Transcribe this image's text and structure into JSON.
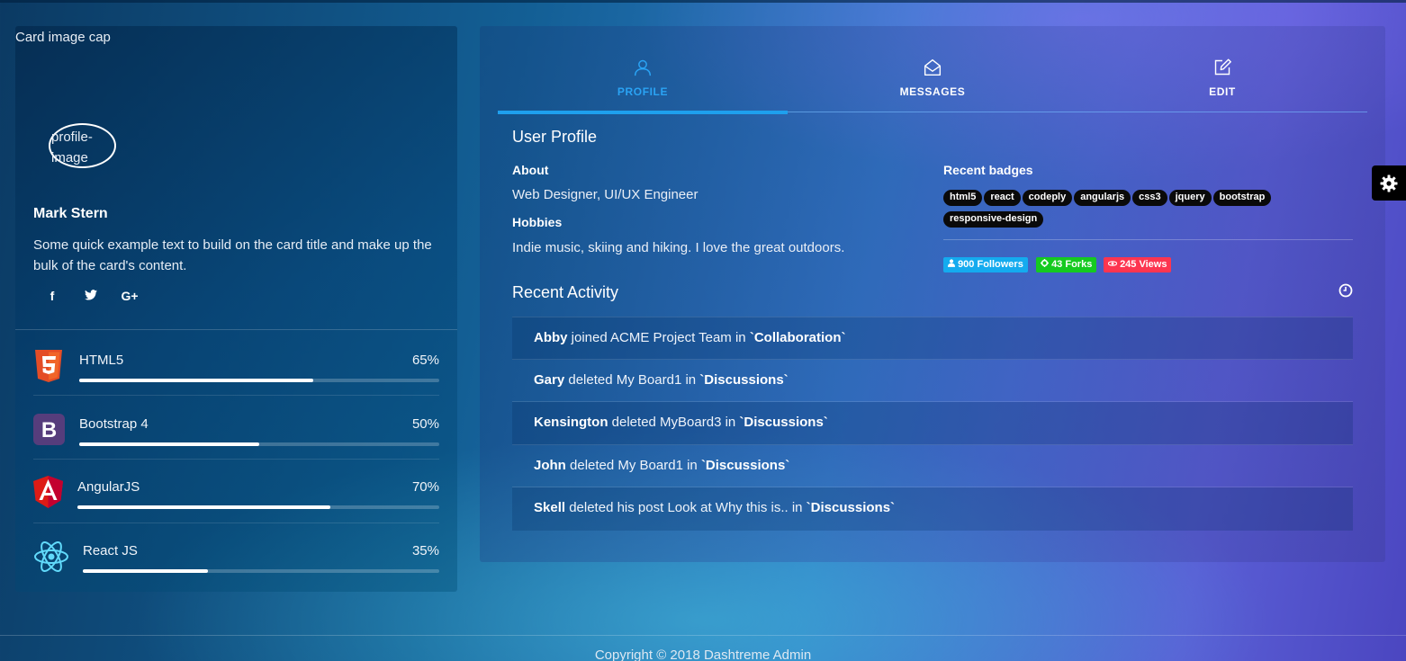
{
  "profile_card": {
    "image_cap": "Card image cap",
    "avatar_alt": "profile-image",
    "name": "Mark Stern",
    "description": "Some quick example text to build on the card title and make up the bulk of the card's content.",
    "social": [
      {
        "icon": "facebook-icon",
        "glyph": "f"
      },
      {
        "icon": "twitter-icon",
        "glyph": "t"
      },
      {
        "icon": "google-plus-icon",
        "glyph": "G+"
      }
    ],
    "skills": [
      {
        "name": "HTML5",
        "percent_label": "65%",
        "value": 65,
        "icon": "html5-icon",
        "color": "#e44d26"
      },
      {
        "name": "Bootstrap 4",
        "percent_label": "50%",
        "value": 50,
        "icon": "bootstrap-icon",
        "color": "#563d7c"
      },
      {
        "name": "AngularJS",
        "percent_label": "70%",
        "value": 70,
        "icon": "angularjs-icon",
        "color": "#dd1b16"
      },
      {
        "name": "React JS",
        "percent_label": "35%",
        "value": 35,
        "icon": "react-icon",
        "color": "#61dafb"
      }
    ]
  },
  "tabs": [
    {
      "label": "PROFILE",
      "icon": "user-icon",
      "active": true
    },
    {
      "label": "MESSAGES",
      "icon": "envelope-open-icon",
      "active": false
    },
    {
      "label": "EDIT",
      "icon": "edit-icon",
      "active": false
    }
  ],
  "user_profile": {
    "title": "User Profile",
    "about_label": "About",
    "about_text": "Web Designer, UI/UX Engineer",
    "hobbies_label": "Hobbies",
    "hobbies_text": "Indie music, skiing and hiking. I love the great outdoors.",
    "badges_label": "Recent badges",
    "badges": [
      "html5",
      "react",
      "codeply",
      "angularjs",
      "css3",
      "jquery",
      "bootstrap",
      "responsive-design"
    ],
    "stats": [
      {
        "text": "900 Followers",
        "icon": "user-icon",
        "color": "#14abef"
      },
      {
        "text": "43 Forks",
        "icon": "cog-icon",
        "color": "#15ca20"
      },
      {
        "text": "245 Views",
        "icon": "eye-icon",
        "color": "#fd3550"
      }
    ]
  },
  "recent_activity": {
    "title": "Recent Activity",
    "items": [
      {
        "user": "Abby",
        "action": " joined ACME Project Team in ",
        "target": "`Collaboration`"
      },
      {
        "user": "Gary",
        "action": " deleted My Board1 in ",
        "target": "`Discussions`"
      },
      {
        "user": "Kensington",
        "action": " deleted MyBoard3 in ",
        "target": "`Discussions`"
      },
      {
        "user": "John",
        "action": " deleted My Board1 in ",
        "target": "`Discussions`"
      },
      {
        "user": "Skell",
        "action": " deleted his post Look at Why this is.. in ",
        "target": "`Discussions`"
      }
    ]
  },
  "footer": {
    "copyright": "Copyright © 2018 Dashtreme Admin"
  }
}
